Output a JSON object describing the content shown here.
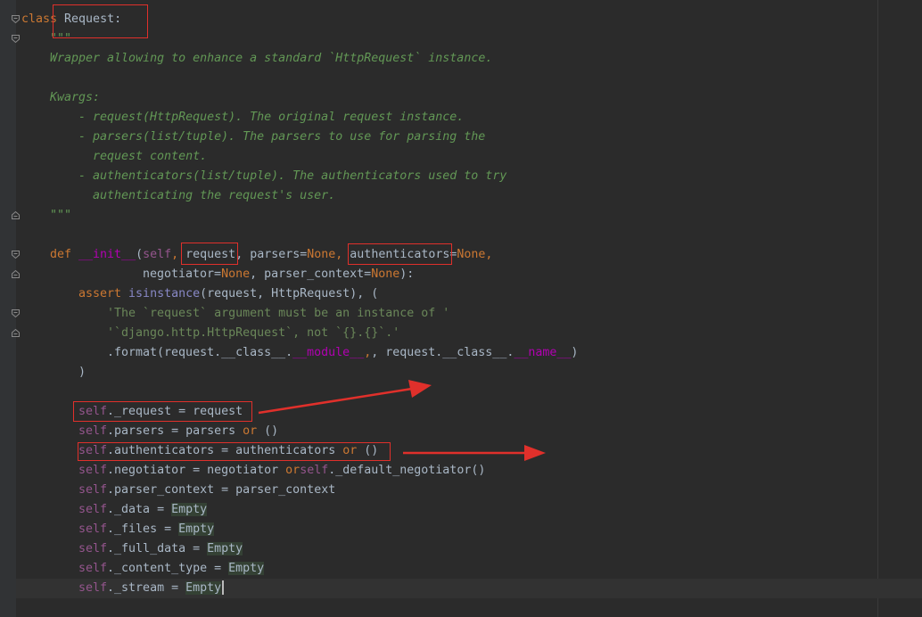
{
  "editor": {
    "lines": {
      "l1_kw": "class",
      "l1_name": " Request:",
      "l2": "\"\"\"",
      "l3": "Wrapper allowing to enhance a standard `HttpRequest` instance.",
      "l5": "Kwargs:",
      "l6": "- request(HttpRequest). The original request instance.",
      "l7": "- parsers(list/tuple). The parsers to use for parsing the",
      "l8": "request content.",
      "l9": "- authenticators(list/tuple). The authenticators used to try",
      "l10": "authenticating the request's user.",
      "l11": "\"\"\"",
      "l13_def": "def ",
      "l13_init": "__init__",
      "l13_open": "(",
      "l13_self": "self",
      "l13_comma": ", ",
      "l13_request": "request",
      "l13_parsers": ", parsers=",
      "l13_none1": "None",
      "l13_sep": ", ",
      "l13_auth": "authenticators",
      "l13_eq": "=",
      "l13_none2": "None",
      "l13_end": ",",
      "l14_neg": "negotiator=",
      "l14_none1": "None",
      "l14_pc": ", parser_context=",
      "l14_none2": "None",
      "l14_end": "):",
      "l15_assert": "assert ",
      "l15_isinstance": "isinstance",
      "l15_rest": "(request, HttpRequest), (",
      "l16": "'The `request` argument must be an instance of '",
      "l17": "'`django.http.HttpRequest`, not `{}.{}`.'",
      "l18_a": ".format(request.__class__.",
      "l18_module": "__module__",
      "l18_b": ", request.__class__.",
      "l18_name": "__name__",
      "l18_c": ")",
      "l19": ")",
      "self": "self",
      "a1": "._request = request",
      "a2_a": ".parsers = parsers ",
      "a2_or": "or",
      "a2_b": " ()",
      "a3_a": ".authenticators = authenticators ",
      "a3_or": "or",
      "a3_b": " ()",
      "a4_a": ".negotiator = negotiator ",
      "a4_or": "or",
      "a4_b": "._default_negotiator()",
      "a5": ".parser_context = parser_context",
      "a6": "._data = ",
      "a7": "._files = ",
      "a8": "._full_data = ",
      "a9": "._content_type = ",
      "a10": "._stream = ",
      "empty": "Empty"
    }
  },
  "annotations": {
    "note1": "",
    "note2": ""
  },
  "colors": {
    "background": "#2b2b2b",
    "keyword": "#cc7832",
    "docstring": "#629755",
    "self": "#94558d",
    "annotation": "#e0302b"
  }
}
